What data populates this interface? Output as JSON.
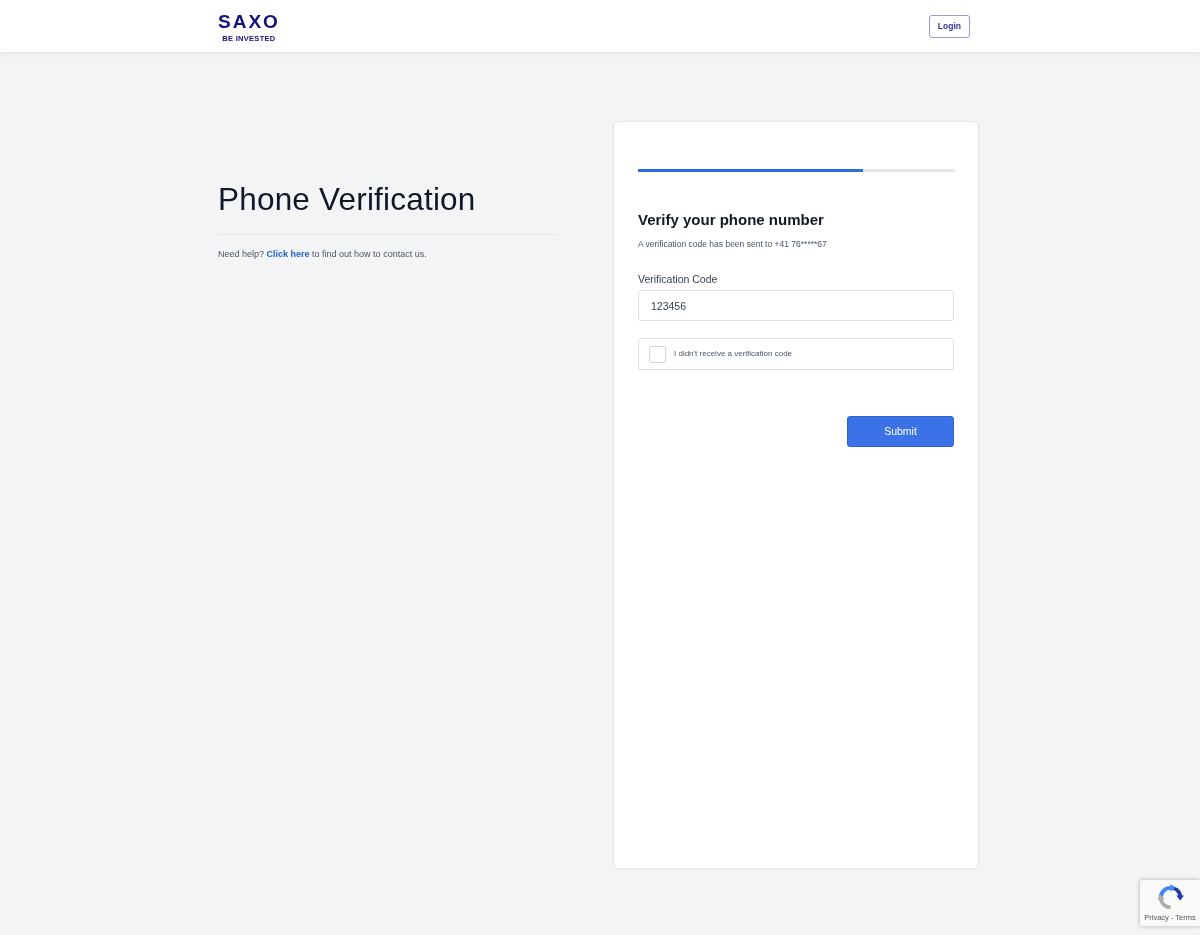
{
  "header": {
    "logo": {
      "wordmark": "SAXO",
      "tagline": "BE INVESTED"
    },
    "login_button": "Login"
  },
  "intro": {
    "title": "Phone Verification",
    "help": {
      "before": "Need help?",
      "link": "Click here",
      "after": "to find out how to contact us."
    }
  },
  "form": {
    "progress": {
      "level": 0.71
    },
    "heading": "Verify your phone number",
    "subtext": "A verification code has been sent to +41 76*****67",
    "code_field": {
      "label": "Verification Code",
      "value": "123456"
    },
    "no_code_checkbox": {
      "label": "I didn't receive a verification code",
      "checked": false
    },
    "submit_button": "Submit"
  },
  "captcha_badge": {
    "links": "Privacy - Terms"
  }
}
